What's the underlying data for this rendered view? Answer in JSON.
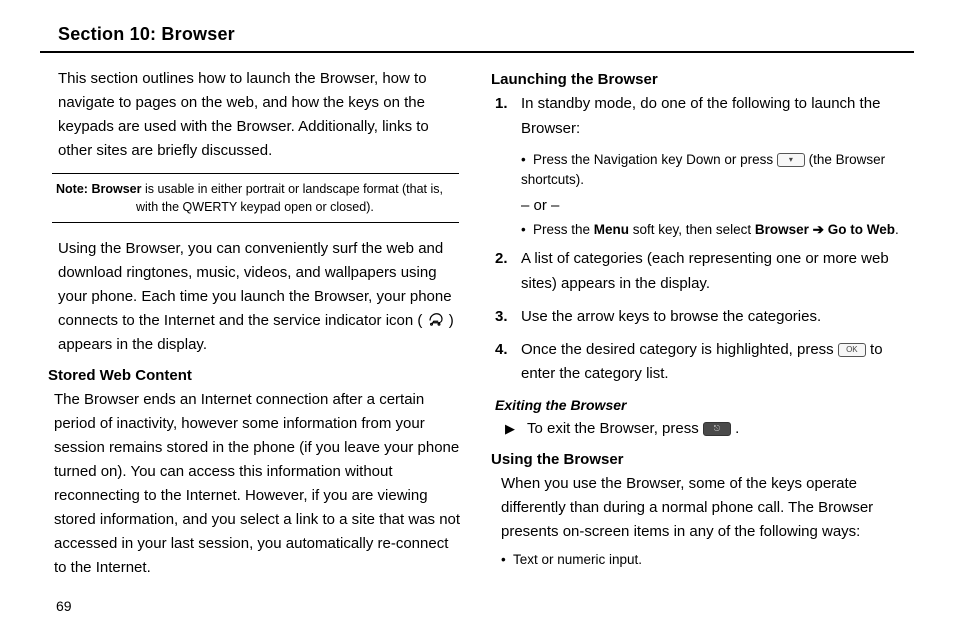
{
  "section_title": "Section 10: Browser",
  "page_number": "69",
  "left": {
    "intro": "This section outlines how to launch the Browser, how to navigate to pages on the web, and how the keys on the keypads are used with the Browser. Additionally, links to other sites are briefly discussed.",
    "note_label": "Note:",
    "note_bold": "Browser",
    "note_rest": " is usable in either portrait or landscape format (that is, with the QWERTY keypad open or closed).",
    "usage_pre": "Using the Browser, you can conveniently surf the web and download ringtones, music, videos, and wallpapers using your phone. Each time you launch the Browser, your phone connects to the Internet and the service indicator icon (",
    "usage_post": ") appears in the display.",
    "stored_heading": "Stored Web Content",
    "stored_text": "The Browser ends an Internet connection after a certain period of inactivity, however some information from your session remains stored in the phone (if you leave your phone turned on). You can access this information without reconnecting to the Internet. However, if you are viewing stored information, and you select a link to a site that was not accessed in your last session, you automatically re-connect to the Internet."
  },
  "right": {
    "launch_heading": "Launching the Browser",
    "step1": "In standby mode, do one of the following to launch the Browser:",
    "bullet1_pre": "Press the Navigation key Down or press ",
    "bullet1_post": " (the Browser shortcuts).",
    "or": "– or –",
    "bullet2_pre": "Press the ",
    "bullet2_menu": "Menu",
    "bullet2_mid": " soft key, then select ",
    "bullet2_browser": "Browser",
    "bullet2_gotoweb": "Go to Web",
    "bullet2_end": ".",
    "step2": "A list of categories (each representing one or more web sites) appears in the display.",
    "step3": "Use the arrow keys to browse the categories.",
    "step4_pre": "Once the desired category is highlighted, press ",
    "step4_post": " to enter the category list.",
    "exit_heading": "Exiting the Browser",
    "exit_pre": "To exit the Browser, press ",
    "exit_post": ".",
    "using_heading": "Using the Browser",
    "using_text": "When you use the Browser, some of the keys operate differently than during a normal phone call. The Browser presents on-screen items in any of the following ways:",
    "using_bullet1": "Text or numeric input."
  },
  "icons": {
    "key_nav": "▾",
    "key_ok": "OK",
    "key_end": "⎋",
    "arrow": "➔"
  }
}
